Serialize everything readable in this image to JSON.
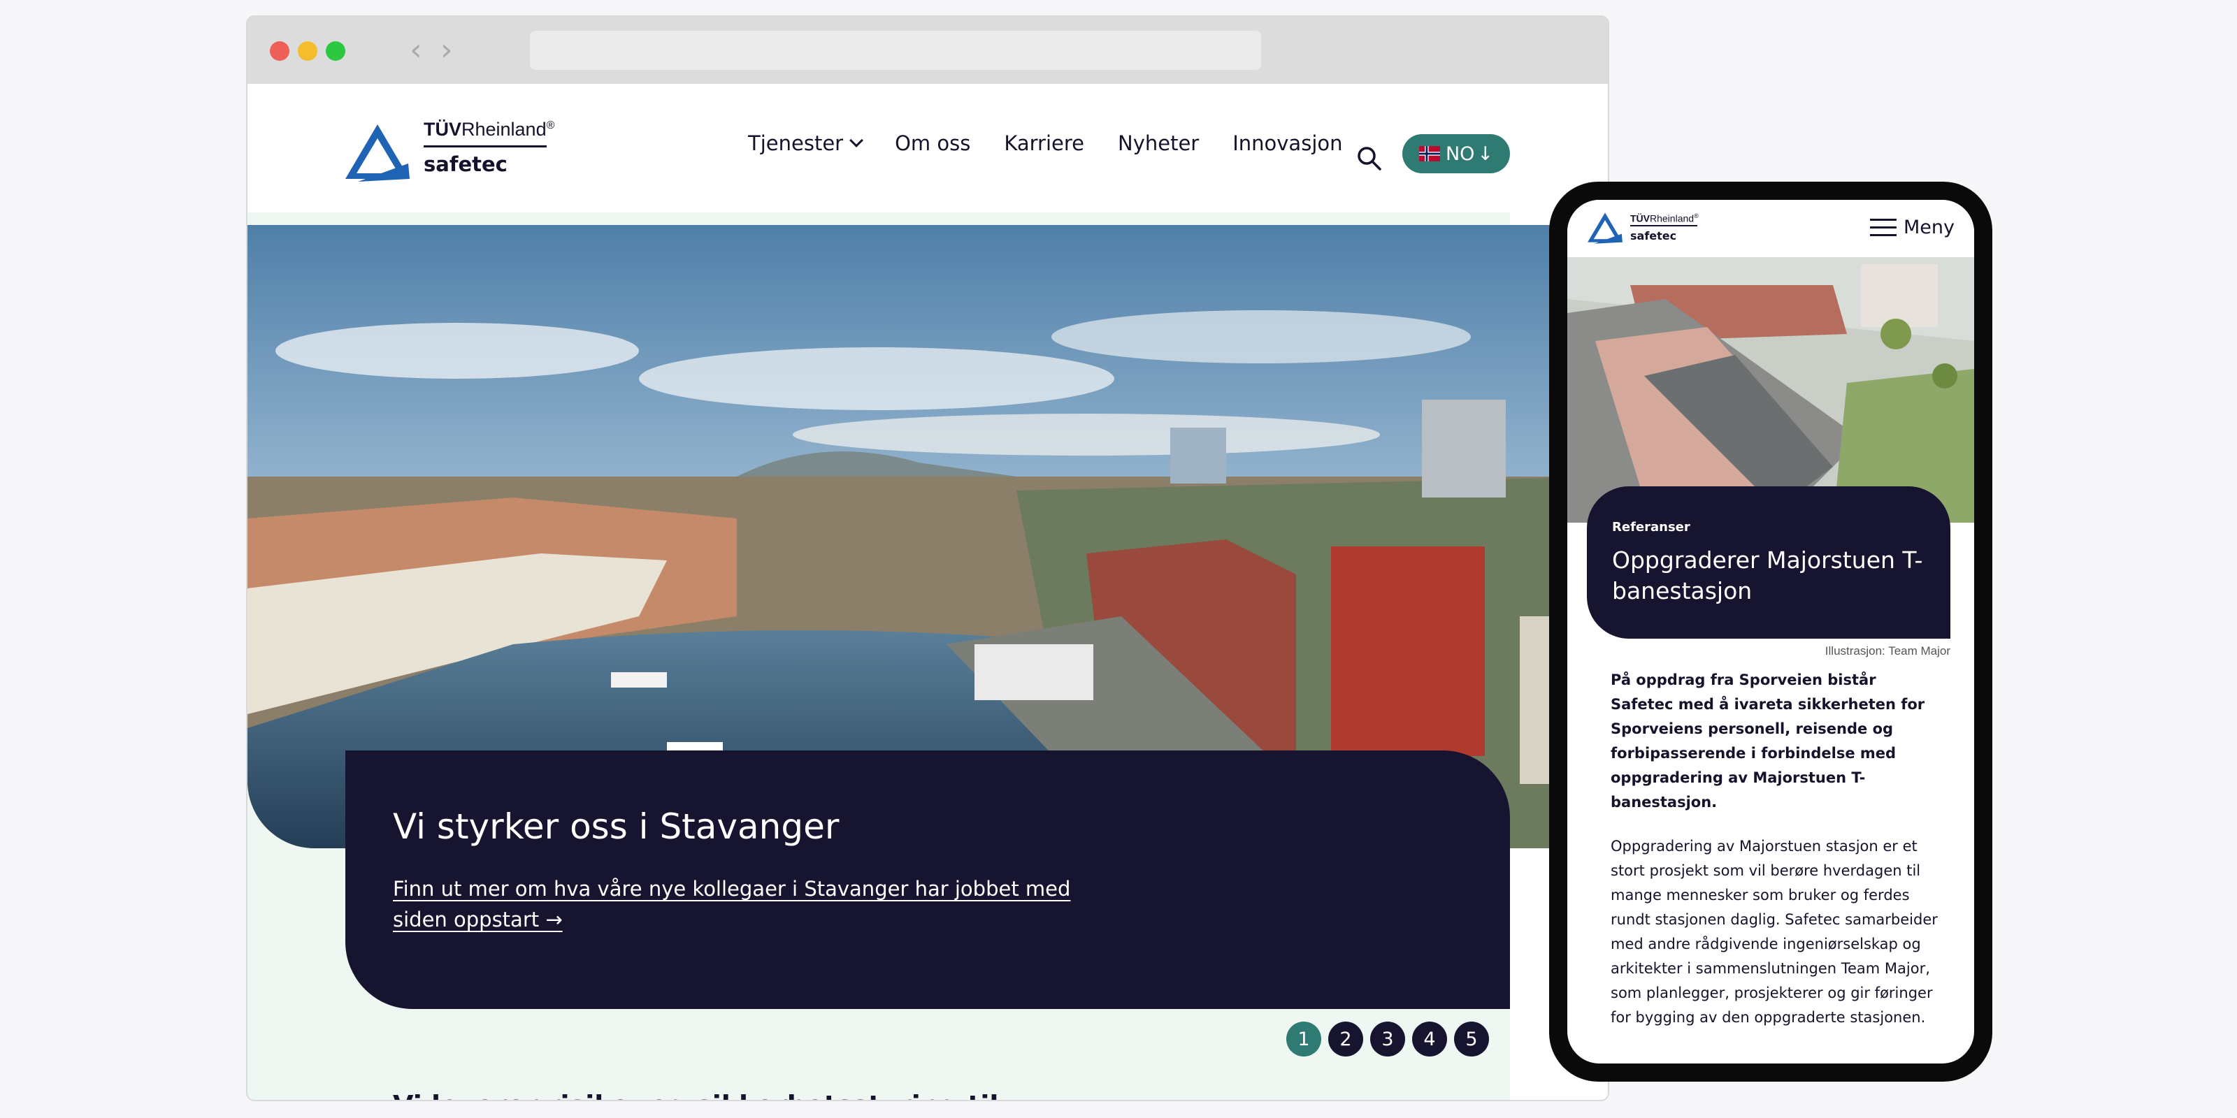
{
  "browser": {
    "controls": {
      "back_icon": "chevron-left",
      "forward_icon": "chevron-right"
    }
  },
  "logo": {
    "brand_prefix": "TÜV",
    "brand_suffix": "Rheinland",
    "registered": "®",
    "company": "safetec"
  },
  "nav": {
    "items": [
      "Tjenester",
      "Om oss",
      "Karriere",
      "Nyheter",
      "Innovasjon"
    ],
    "search_icon": "search-icon",
    "language": {
      "label": "NO",
      "arrow": "↓"
    }
  },
  "hero": {
    "title": "Vi styrker oss i Stavanger",
    "link_text": "Finn ut mer om hva våre nye kollegaer i Stavanger har jobbet med siden oppstart →",
    "pagination": [
      "1",
      "2",
      "3",
      "4",
      "5"
    ],
    "active_page": "1"
  },
  "section": {
    "heading": "Vi leverer risiko- og sikkerhetsstyring til"
  },
  "mobile": {
    "menu_label": "Meny",
    "card": {
      "kicker": "Referanser",
      "title": "Oppgraderer Majorstuen T-banestasjon"
    },
    "image_credit": "Illustrasjon: Team Major",
    "lead": "På oppdrag fra Sporveien bistår Safetec med å ivareta sikkerheten for Sporveiens personell, reisende og forbipasserende i forbindelse med oppgradering av Majorstuen T-banestasjon.",
    "body": "Oppgradering av Majorstuen stasjon er et stort prosjekt som vil berøre hverdagen til mange mennesker som bruker og ferdes rundt stasjonen daglig. Safetec samarbeider med andre rådgivende ingeniørselskap og arkitekter i sammenslutningen Team Major, som planlegger, prosjekterer og gir føringer for bygging av den oppgraderte stasjonen."
  },
  "colors": {
    "navy": "#17142f",
    "teal": "#2f7a73",
    "mint": "#eef7f1"
  }
}
